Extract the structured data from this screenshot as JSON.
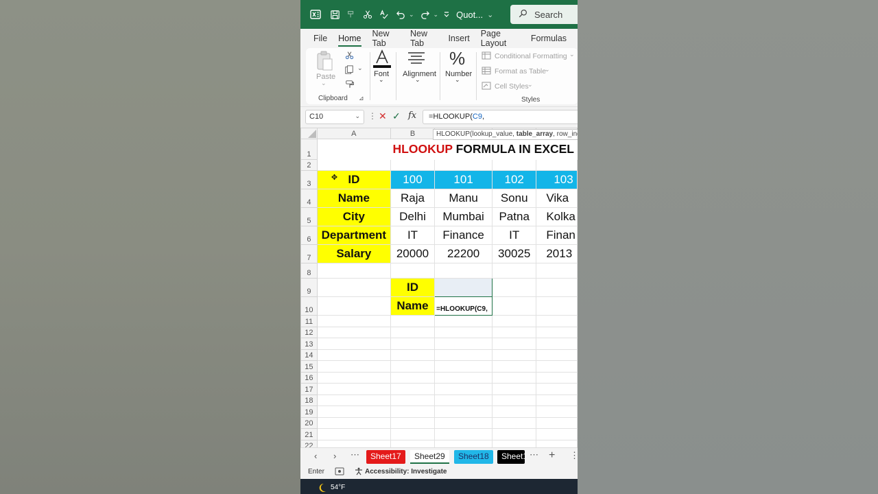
{
  "titlebar": {
    "doc_title": "Quot...",
    "search_placeholder": "Search"
  },
  "ribbon_tabs": [
    "File",
    "Home",
    "New Tab",
    "New Tab",
    "Insert",
    "Page Layout",
    "Formulas"
  ],
  "ribbon": {
    "paste": "Paste",
    "clipboard": "Clipboard",
    "font": "Font",
    "alignment": "Alignment",
    "number": "Number",
    "conditional_formatting": "Conditional Formatting",
    "format_as_table": "Format as Table",
    "cell_styles": "Cell Styles",
    "styles": "Styles"
  },
  "formula_bar": {
    "name_box": "C10",
    "formula_prefix": "=HLOOKUP(",
    "formula_ref": "C9",
    "formula_suffix": ","
  },
  "tooltip": {
    "prefix": "HLOOKUP(lookup_value, ",
    "bold_arg": "table_array",
    "suffix": ", row_ind"
  },
  "columns": [
    "A",
    "B",
    "",
    "",
    ""
  ],
  "rows": [
    "1",
    "2",
    "3",
    "4",
    "5",
    "6",
    "7",
    "8",
    "9",
    "10",
    "11",
    "12",
    "13",
    "14",
    "15",
    "16",
    "17",
    "18",
    "19",
    "20",
    "21",
    "22"
  ],
  "sheet": {
    "title_red": "HLOOKUP",
    "title_black": " FORMULA IN EXCEL",
    "header_labels": [
      "ID",
      "Name",
      "City",
      "Department",
      "Salary"
    ],
    "id_row": [
      "100",
      "101",
      "102",
      "103"
    ],
    "name_row": [
      "Raja",
      "Manu",
      "Sonu",
      "Vika"
    ],
    "city_row": [
      "Delhi",
      "Mumbai",
      "Patna",
      "Kolka"
    ],
    "dept_row": [
      "IT",
      "Finance",
      "IT",
      "Finan"
    ],
    "salary_row": [
      "20000",
      "22200",
      "30025",
      "2013"
    ],
    "lookup_id_label": "ID",
    "lookup_name_label": "Name",
    "editing_text": "=HLOOKUP(C9,"
  },
  "sheet_tabs": [
    "Sheet17",
    "Sheet29",
    "Sheet18",
    "Sheet1"
  ],
  "status": {
    "mode": "Enter",
    "accessibility": "Accessibility: Investigate"
  },
  "taskbar": {
    "weather": "54°F"
  },
  "colors": {
    "excel_green": "#1e7145",
    "header_yellow": "#ffff00",
    "id_cyan": "#13b5e8",
    "title_red": "#d01010"
  }
}
